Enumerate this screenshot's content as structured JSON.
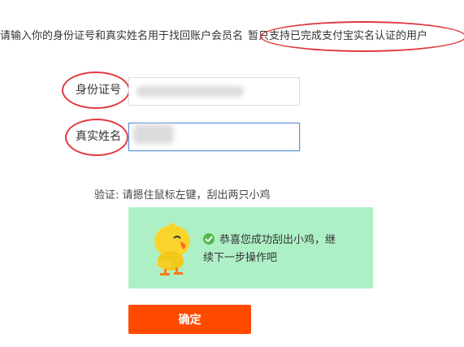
{
  "notice": {
    "text": "请输入你的身份证号和真实姓名用于找回账户会员名",
    "highlight": "暂只支持已完成支付宝实名认证的用户"
  },
  "form": {
    "id_label": "身份证号",
    "id_value": "",
    "name_label": "真实姓名",
    "name_value": ""
  },
  "verify": {
    "label": "验证:",
    "instruction": "请摁住鼠标左键，刮出两只小鸡",
    "success_line1": "恭喜您成功刮出小鸡，继",
    "success_line2": "续下一步操作吧",
    "success_icon": "check-circle-icon",
    "mascot_icon": "chick-icon"
  },
  "submit_label": "确定",
  "colors": {
    "accent": "#ff4a00",
    "captcha_bg": "#aef0c6",
    "annotation": "#e0393f",
    "success": "#52b94c"
  }
}
